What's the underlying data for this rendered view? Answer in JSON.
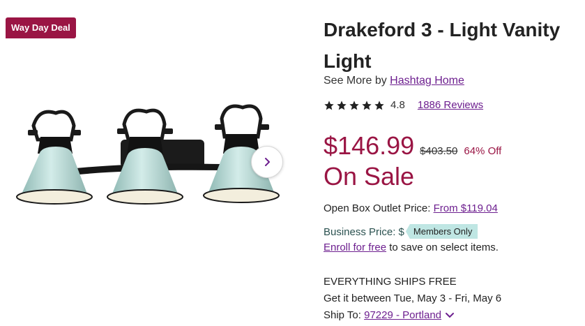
{
  "badge": {
    "label": "Way Day Deal"
  },
  "product": {
    "title": "Drakeford 3 - Light Vanity Light",
    "see_more_prefix": "See More by",
    "brand": "Hashtag Home",
    "rating": "4.8",
    "stars": 5,
    "reviews": "1886 Reviews",
    "image_icon": "vanity-light-image"
  },
  "pricing": {
    "current": "$146.99",
    "original": "$403.50",
    "discount": "64% Off",
    "sale_label": "On Sale",
    "outlet_label": "Open Box Outlet Price:",
    "outlet_link": "From $119.04",
    "business_label": "Business Price:",
    "business_value": "$",
    "members_tag": "Members Only",
    "enroll_link": "Enroll for free",
    "enroll_suffix": "to save on select items."
  },
  "shipping": {
    "free_label": "EVERYTHING SHIPS FREE",
    "delivery": "Get it between Tue, May 3 - Fri, May 6",
    "ship_to_label": "Ship To:",
    "location": "97229 - Portland"
  },
  "icons": {
    "next": "chevron-right-icon",
    "star": "star-icon",
    "dropdown": "chevron-down-icon"
  },
  "colors": {
    "brand": "#9a1544",
    "link": "#6d1f8f",
    "members_bg": "#bfe6e3",
    "shade": "#b7d8d4"
  }
}
